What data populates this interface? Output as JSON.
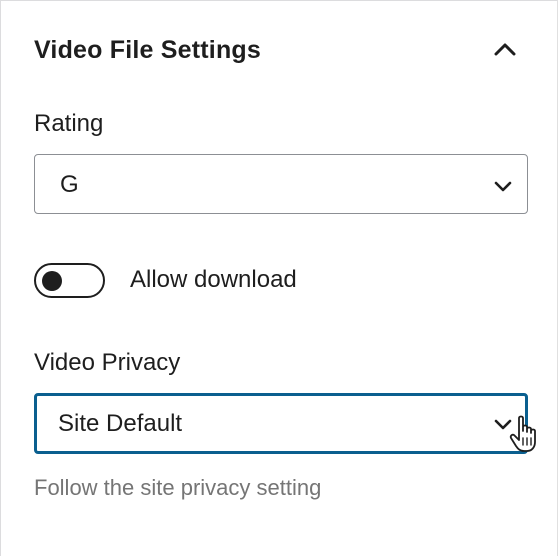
{
  "panel": {
    "title": "Video File Settings",
    "collapse_icon": "chevron-up-icon"
  },
  "rating": {
    "label": "Rating",
    "selected": "G",
    "dropdown_icon": "chevron-down-icon"
  },
  "download": {
    "label": "Allow download",
    "enabled": false
  },
  "privacy": {
    "label": "Video Privacy",
    "selected": "Site Default",
    "dropdown_icon": "chevron-down-icon",
    "help": "Follow the site privacy setting"
  },
  "cursor": {
    "icon": "hand-pointer-cursor-icon"
  },
  "colors": {
    "text": "#1e1e1e",
    "help_text": "#757575",
    "focus_border": "#0a5f8f",
    "field_border": "#8c8f94"
  }
}
